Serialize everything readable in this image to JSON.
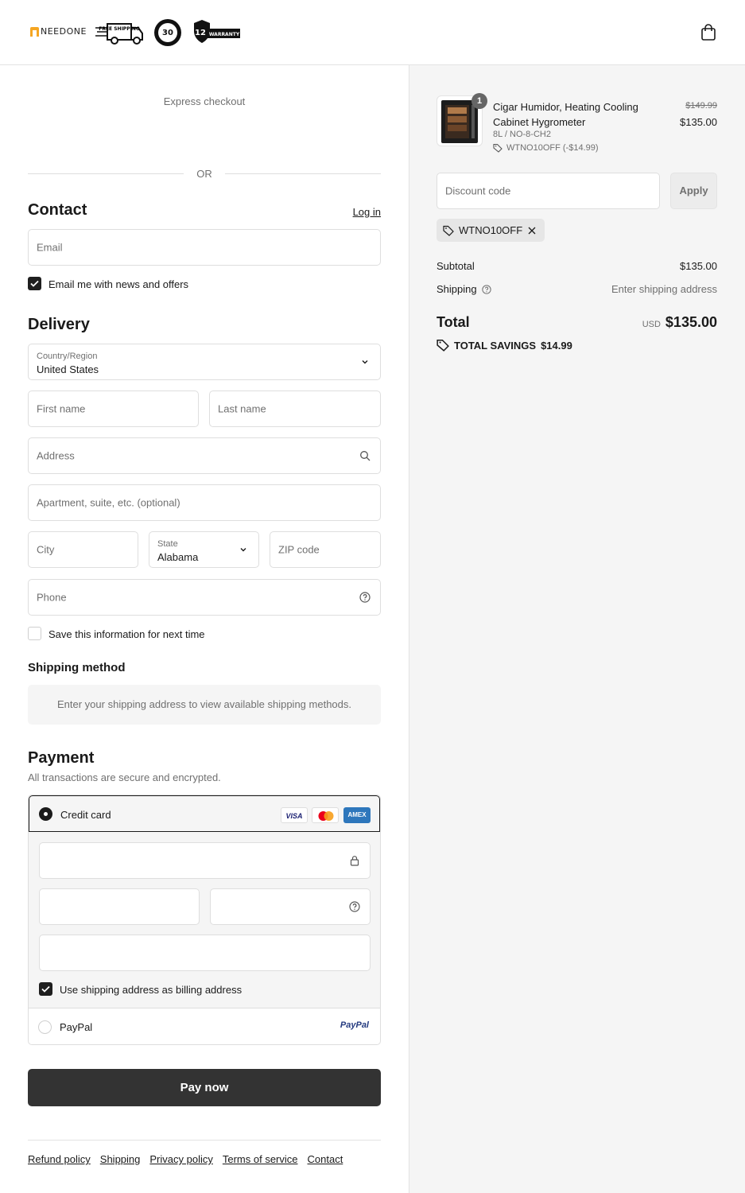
{
  "brand": {
    "name": "NEEDONE"
  },
  "badges": [
    {
      "label": "FREE SHIPPING"
    },
    {
      "label": "30"
    },
    {
      "label": "12"
    },
    {
      "label": "WARRANTY"
    }
  ],
  "express": {
    "label": "Express checkout",
    "or": "OR"
  },
  "contact": {
    "title": "Contact",
    "login": "Log in",
    "email_placeholder": "Email",
    "news_label": "Email me with news and offers",
    "news_checked": true
  },
  "delivery": {
    "title": "Delivery",
    "country_label": "Country/Region",
    "country_value": "United States",
    "first_name": "First name",
    "last_name": "Last name",
    "address": "Address",
    "apartment": "Apartment, suite, etc. (optional)",
    "city": "City",
    "state_label": "State",
    "state_value": "Alabama",
    "zip": "ZIP code",
    "phone": "Phone",
    "save_label": "Save this information for next time",
    "save_checked": false
  },
  "shipping": {
    "title": "Shipping method",
    "message": "Enter your shipping address to view available shipping methods."
  },
  "payment": {
    "title": "Payment",
    "subtitle": "All transactions are secure and encrypted.",
    "credit_card": "Credit card",
    "cards": [
      "VISA",
      "MC",
      "AMEX"
    ],
    "billing_label": "Use shipping address as billing address",
    "billing_checked": true,
    "paypal_label": "PayPal",
    "paypal_logo": "PayPal"
  },
  "pay_now": "Pay now",
  "footer": [
    "Refund policy",
    "Shipping",
    "Privacy policy",
    "Terms of service",
    "Contact"
  ],
  "summary": {
    "product": {
      "quantity": "1",
      "name": "Cigar Humidor, Heating Cooling Cabinet Hygrometer",
      "variant": "8L / NO-8-CH2",
      "discount": "WTNO10OFF (-$14.99)",
      "old_price": "$149.99",
      "price": "$135.00"
    },
    "discount_placeholder": "Discount code",
    "apply": "Apply",
    "applied_code": "WTNO10OFF",
    "subtotal_label": "Subtotal",
    "subtotal_value": "$135.00",
    "shipping_label": "Shipping",
    "shipping_value": "Enter shipping address",
    "total_label": "Total",
    "currency": "USD",
    "total_value": "$135.00",
    "savings_label": "TOTAL SAVINGS",
    "savings_value": "$14.99"
  },
  "colors": {
    "button": "#333333",
    "panel": "#f5f5f5",
    "border": "#dedede",
    "muted": "#707070",
    "brand_accent": "#f5a623"
  }
}
